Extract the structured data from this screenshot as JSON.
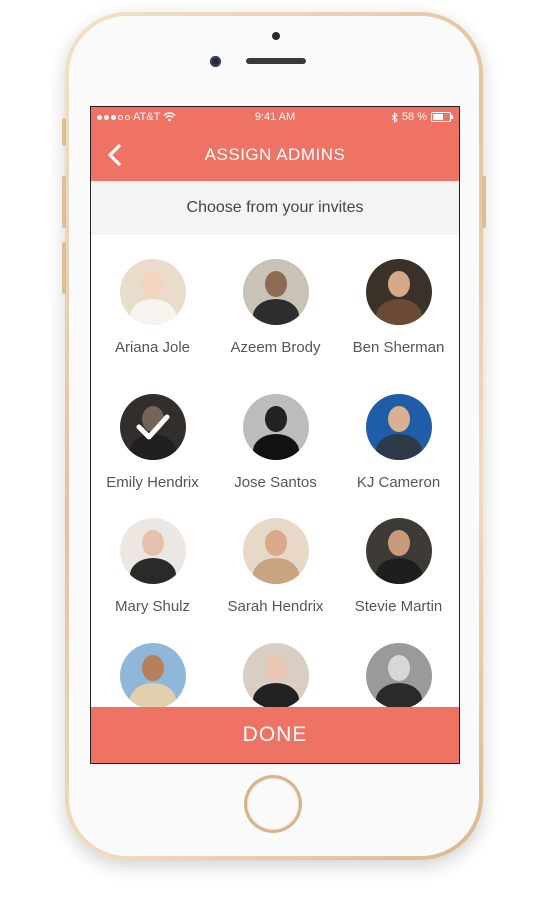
{
  "status_bar": {
    "carrier": "AT&T",
    "time": "9:41 AM",
    "battery": "58 %",
    "signal_bars_filled": 3
  },
  "header": {
    "title": "ASSIGN ADMINS",
    "back_icon": "chevron-left-icon",
    "accent_color": "#ef7365"
  },
  "subheader": {
    "text": "Choose from your invites"
  },
  "invites": [
    {
      "name": "Ariana Jole",
      "selected": false,
      "bg": "#e9dccb",
      "skin": "#f2d4bf",
      "cloth": "#f7f3ee"
    },
    {
      "name": "Azeem Brody",
      "selected": false,
      "bg": "#c9c2b6",
      "skin": "#8d6a52",
      "cloth": "#2e2e2e"
    },
    {
      "name": "Ben Sherman",
      "selected": false,
      "bg": "#3a3128",
      "skin": "#d6a88a",
      "cloth": "#6b4a33"
    },
    {
      "name": "Emily Hendrix",
      "selected": true,
      "bg": "#5a5550",
      "skin": "#d7b4a0",
      "cloth": "#3b3b3b"
    },
    {
      "name": "Jose Santos",
      "selected": false,
      "bg": "#bcbcbc",
      "skin": "#222222",
      "cloth": "#111111"
    },
    {
      "name": "KJ Cameron",
      "selected": false,
      "bg": "#1f5da8",
      "skin": "#d9b091",
      "cloth": "#2f3a48"
    },
    {
      "name": "Mary Shulz",
      "selected": false,
      "bg": "#ece7e2",
      "skin": "#e6c2ae",
      "cloth": "#2b2a2a"
    },
    {
      "name": "Sarah Hendrix",
      "selected": false,
      "bg": "#e8d8c8",
      "skin": "#d9a98a",
      "cloth": "#c9a483"
    },
    {
      "name": "Stevie Martin",
      "selected": false,
      "bg": "#3e3a36",
      "skin": "#c99a7c",
      "cloth": "#1e1e1e"
    },
    {
      "name": "",
      "selected": false,
      "bg": "#8fb7d9",
      "skin": "#b77f5c",
      "cloth": "#e2cfae"
    },
    {
      "name": "",
      "selected": false,
      "bg": "#d9cec3",
      "skin": "#e8c6b2",
      "cloth": "#222222"
    },
    {
      "name": "",
      "selected": false,
      "bg": "#9a9a9a",
      "skin": "#d7d7d7",
      "cloth": "#2a2a2a"
    }
  ],
  "footer": {
    "done_label": "DONE"
  }
}
